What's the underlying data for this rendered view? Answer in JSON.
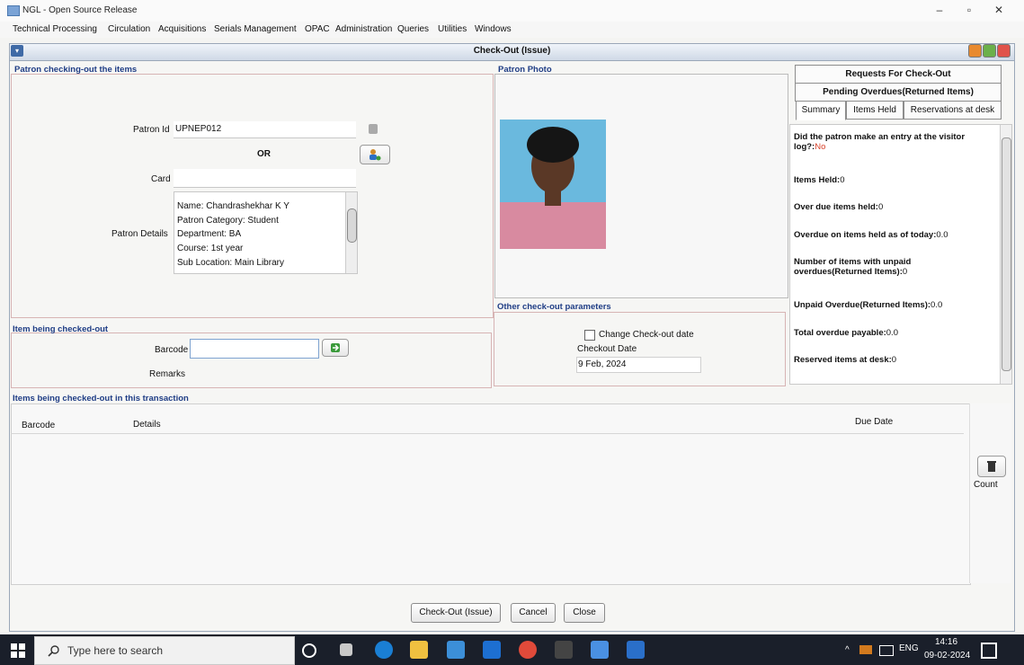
{
  "window": {
    "app_title": "NGL - Open Source Release",
    "controls": {
      "minimize": "–",
      "maximize": "▫",
      "close": "✕"
    }
  },
  "menu": [
    "Technical Processing",
    "Circulation",
    "Acquisitions",
    "Serials Management",
    "OPAC",
    "Administration",
    "Queries",
    "Utilities",
    "Windows"
  ],
  "frame": {
    "title": "Check-Out (Issue)"
  },
  "patron_section": {
    "title": "Patron checking-out the items",
    "patron_id_label": "Patron Id",
    "patron_id_value": "UPNEP012",
    "or_label": "OR",
    "card_label": "Card",
    "details_label": "Patron Details",
    "details_lines": [
      "Name: Chandrashekhar K Y",
      "Patron Category: Student",
      "Department: BA",
      "Course: 1st year",
      "Sub Location: Main Library"
    ]
  },
  "photo_section": {
    "title": "Patron Photo"
  },
  "right_tabs": {
    "requests": "Requests For Check-Out",
    "pending": "Pending Overdues(Returned Items)",
    "summary": "Summary",
    "items_held": "Items Held",
    "reservations": "Reservations at desk"
  },
  "summary": {
    "visitor_log_label": "Did the patron make an entry at the visitor log?:",
    "visitor_log_value": "No",
    "items_held_label": "Items Held:",
    "items_held_value": "0",
    "overdue_items_label": "Over due items held:",
    "overdue_items_value": "0",
    "overdue_today_label": "Overdue on items held as of today:",
    "overdue_today_value": "0.0",
    "unpaid_items_label": "Number of items with unpaid overdues(Returned Items):",
    "unpaid_items_value": "0",
    "unpaid_overdue_label": "Unpaid Overdue(Returned Items):",
    "unpaid_overdue_value": "0.0",
    "total_payable_label": "Total overdue payable:",
    "total_payable_value": "0.0",
    "reserved_label": "Reserved items at desk:",
    "reserved_value": "0"
  },
  "item_section": {
    "title": "Item being checked-out",
    "barcode_label": "Barcode",
    "remarks_label": "Remarks"
  },
  "params_section": {
    "title": "Other check-out parameters",
    "change_date_label": "Change Check-out date",
    "checkout_date_label": "Checkout Date",
    "checkout_date_value": "9 Feb, 2024"
  },
  "transaction_section": {
    "title": "Items being checked-out in this transaction",
    "columns": [
      "Barcode",
      "Details",
      "Due Date"
    ],
    "count_label": "Count"
  },
  "actions": {
    "checkout": "Check-Out (Issue)",
    "cancel": "Cancel",
    "close": "Close"
  },
  "taskbar": {
    "search_placeholder": "Type here to search",
    "lang": "ENG",
    "time": "14:16",
    "date": "09-02-2024"
  }
}
